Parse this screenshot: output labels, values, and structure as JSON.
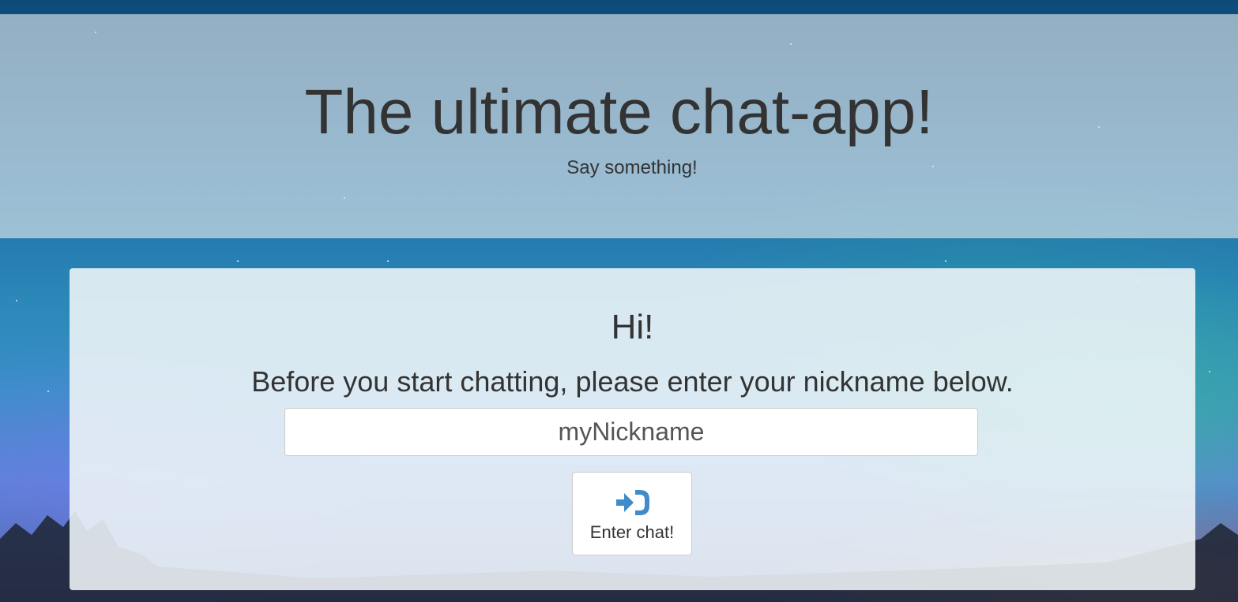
{
  "header": {
    "title": "The ultimate chat-app!",
    "subtitle": "Say something!"
  },
  "login_panel": {
    "greeting": "Hi!",
    "instructions": "Before you start chatting, please enter your nickname below.",
    "nickname_input": {
      "value": "",
      "placeholder": "myNickname"
    },
    "enter_button": {
      "label": "Enter chat!",
      "icon": "log-in-icon"
    }
  },
  "colors": {
    "accent": "#428bca",
    "text": "#333333"
  }
}
